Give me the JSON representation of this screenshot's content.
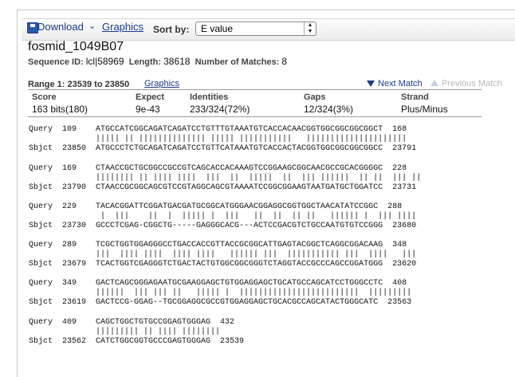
{
  "toolbar": {
    "download_label": "Download",
    "download_chevron": "⌄",
    "graphics_label": "Graphics",
    "sort_label": "Sort by:",
    "sort_value": "E value"
  },
  "sequence": {
    "title": "fosmid_1049B07",
    "id_label": "Sequence ID:",
    "id_value": "lcl|58969",
    "length_label": "Length:",
    "length_value": "38618",
    "matches_label": "Number of Matches:",
    "matches_value": "8"
  },
  "range": {
    "label": "Range 1: 23539 to 23850",
    "graphics_link": "Graphics",
    "next_label": "Next Match",
    "prev_label": "Previous Match"
  },
  "stats": {
    "headers": [
      "Score",
      "Expect",
      "Identities",
      "Gaps",
      "Strand"
    ],
    "values": [
      "163 bits(180)",
      "9e-43",
      "233/324(72%)",
      "12/324(3%)",
      "Plus/Minus"
    ]
  },
  "alignment": [
    {
      "query": "Query  109    ATGCCATCGGCAGATCAGATCCTGTTTGTAAATGTCACCACAACGGTGGCGGCGGCGGCT  168",
      "mid": "              ||||| || |||||||||||||| ||||| |||||||||||   |||||||||||||||||||||",
      "sbjct": "Sbjct  23850  ATGCCCTCTGCAGATCAGATCCTGTTCATAAATGTCACCACTACGGTGGCGGCGGCGGCC  23791"
    },
    {
      "query": "Query  169    CTAACCGCTGCGGCCGCCGTCAGCACCACAAAGTCCGGAAGCGGCAACGCCGCACGGGGC  228",
      "mid": "              |||||||| || |||| ||||  |||  ||  |||||  ||  ||| ||||||  || ||  ||| ||",
      "sbjct": "Sbjct  23790  CTAACCGCGGCAGCGTCCGTAGGCAGCGTAAAATCCGGCGGAAGTAATGATGCTGGATCC  23731"
    },
    {
      "query": "Query  229    TACACGGATTCGGATGACGATGCGGCATGGGAACGGAGGCGGTGGCTAACATATCCGGC  288",
      "mid": "               |  |||    ||  |  ||||| |  |||   ||  ||  || ||   |||||| |  ||| ||||",
      "sbjct": "Sbjct  23730  GCCCTCGAG-CGGCTG-----GAGGGCACG---ACTCCGACGTCTGCCAATGTGTCCGGG  23680"
    },
    {
      "query": "Query  289    TCGCTGGTGGAGGGCCTGACCACCGTTACCGCGGCATTGAGTACGGCTCAGGCGGACAAG  348",
      "mid": "              |||  |||| ||||  |||| ||||   |||||| |||  ||||||||||| |||  ||||   |||",
      "sbjct": "Sbjct  23679  TCACTGGTCGAGGGTCTGACTACTGTGGCGGCGGGTCTAGGTACCGCCCAGCCGGATGGG  23620"
    },
    {
      "query": "Query  349    GACTCAGCGGGAGAATGCGAAGGAGCTGTGGAGGAGCTGCATGCCAGCATCCTGGGCCTC  408",
      "mid": "              ||||||  ||| ||| ||   ||||| |  |||||||||||||||||||||||||  |||||||||",
      "sbjct": "Sbjct  23619  GACTCCG-GGAG--TGCGGAGGCGCCGTGGAGGAGCTGCACGCCAGCATACTGGGCATC  23563"
    },
    {
      "query": "Query  409    CAGCTGGCTGTGCCGGAGTGGGAG  432",
      "mid": "              ||||||||| || |||| ||||||||",
      "sbjct": "Sbjct  23562  CATCTGGCGGTGCCCGAGTGGGAG  23539"
    }
  ]
}
